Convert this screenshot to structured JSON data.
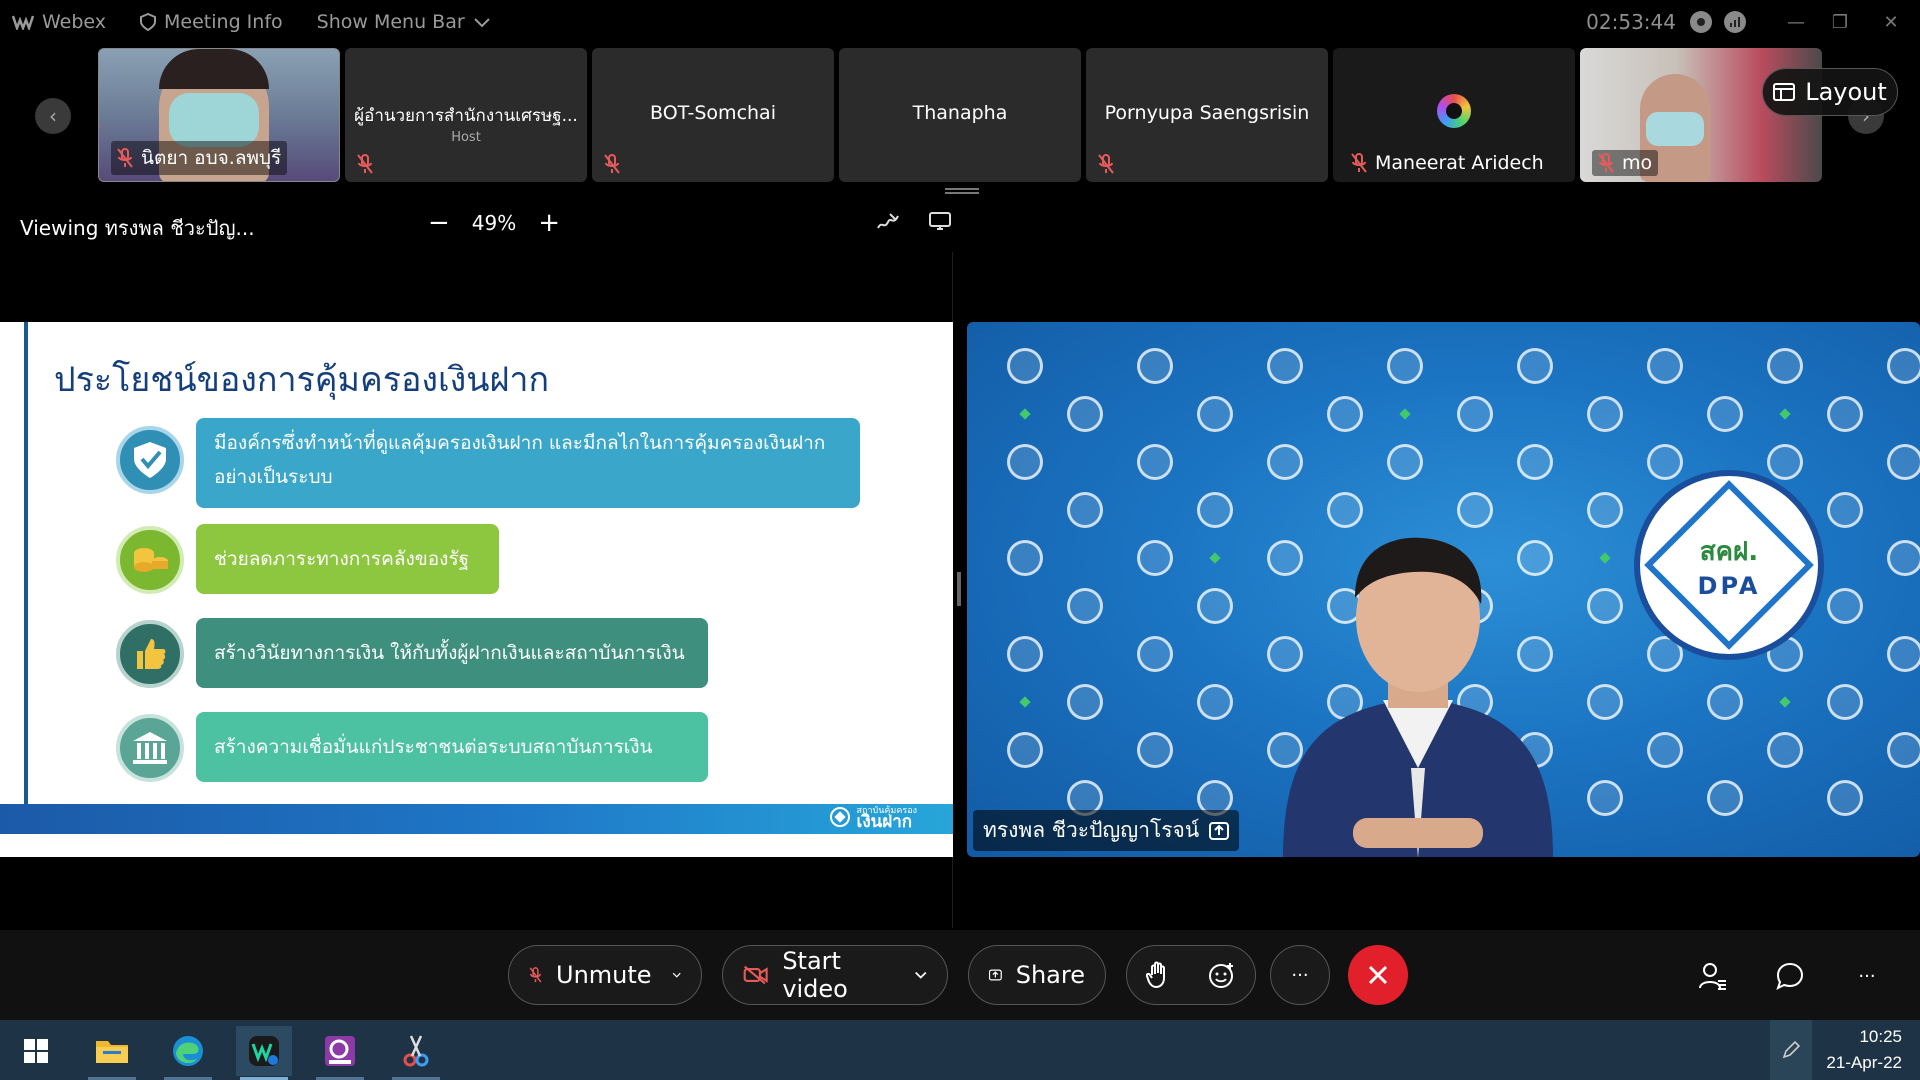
{
  "titlebar": {
    "app": "Webex",
    "meeting_info": "Meeting Info",
    "show_menu_bar": "Show Menu Bar",
    "time": "02:53:44"
  },
  "participants": [
    {
      "name": "นิตยา อบจ.ลพบุรี",
      "muted": true,
      "video": true
    },
    {
      "name": "ผู้อำนวยการสำนักงานเศรษฐ...",
      "sub": "Host",
      "muted": true,
      "video": false
    },
    {
      "name": "BOT-Somchai",
      "muted": true,
      "video": false
    },
    {
      "name": "Thanapha",
      "muted": false,
      "video": false
    },
    {
      "name": "Pornyupa Saengsrisin",
      "muted": true,
      "video": false
    },
    {
      "name": "Maneerat Aridech",
      "muted": true,
      "video": false
    },
    {
      "name": "mo",
      "muted": true,
      "video": true
    }
  ],
  "layout_label": "Layout",
  "viewing": {
    "label": "Viewing ทรงพล ชีวะปัญ...",
    "zoom": "49%",
    "minus": "−",
    "plus": "+"
  },
  "slide": {
    "title": "ประโยชน์ของการคุ้มครองเงินฝาก",
    "bullets": [
      {
        "text_line1": "มีองค์กรซึ่งทำหน้าที่ดูแลคุ้มครองเงินฝาก และมีกลไกในการคุ้มครองเงินฝาก",
        "text_line2": "อย่างเป็นระบบ",
        "color": "#3aa6c9",
        "icon_color": "#2f8fb4",
        "icon": "shield-check-icon"
      },
      {
        "text_line1": "ช่วยลดภาระทางการคลังของรัฐ",
        "color": "#8dc63f",
        "icon_color": "#7cb82f",
        "icon": "coins-icon"
      },
      {
        "text_line1": "สร้างวินัยทางการเงิน ให้กับทั้งผู้ฝากเงินและสถาบันการเงิน",
        "color": "#3f8f7f",
        "icon_color": "#2f6f66",
        "icon": "thumbs-up-icon"
      },
      {
        "text_line1": "สร้างความเชื่อมั่นแก่ประชาชนต่อระบบสถาบันการเงิน",
        "color": "#4cc2a3",
        "icon_color": "#5aa596",
        "icon": "bank-icon"
      }
    ],
    "footer_logo_small": "สถาบันคุ้มครอง",
    "footer_logo": "เงินฝาก"
  },
  "speaker": {
    "name": "ทรงพล ชีวะปัญญาโรจน์",
    "logo_th": "สคฝ.",
    "logo_en": "DPA"
  },
  "controls": {
    "unmute": "Unmute",
    "start_video": "Start video",
    "share": "Share",
    "more": "···"
  },
  "taskbar": {
    "time": "10:25",
    "date": "21-Apr-22"
  },
  "colors": {
    "end_call": "#e2202c",
    "slide_title": "#143f7c",
    "taskbar": "#1e3446"
  }
}
